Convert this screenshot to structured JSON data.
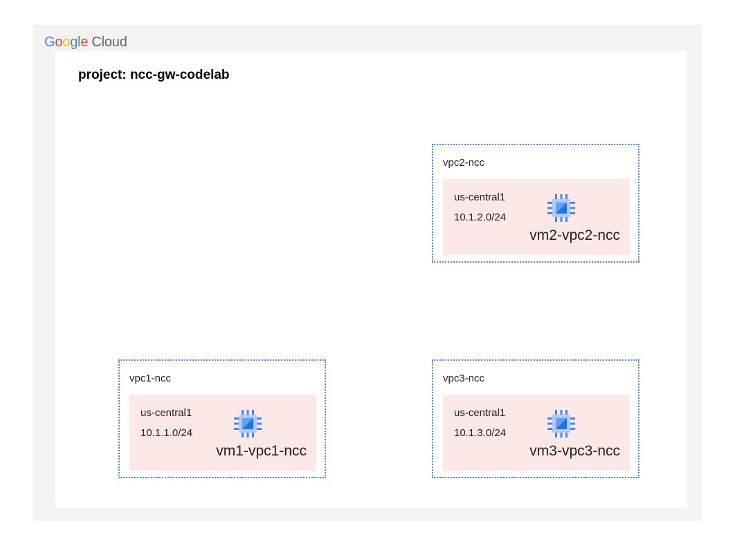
{
  "brand": {
    "google_letters": [
      {
        "ch": "G",
        "color": "#4285F4"
      },
      {
        "ch": "o",
        "color": "#EA4335"
      },
      {
        "ch": "o",
        "color": "#FBBC05"
      },
      {
        "ch": "g",
        "color": "#4285F4"
      },
      {
        "ch": "l",
        "color": "#34A853"
      },
      {
        "ch": "e",
        "color": "#EA4335"
      }
    ],
    "product": "Cloud"
  },
  "project": {
    "label": "project: ncc-gw-codelab"
  },
  "vpcs": {
    "vpc2": {
      "name": "vpc2-ncc",
      "region": "us-central1",
      "cidr": "10.1.2.0/24",
      "vm": "vm2-vpc2-ncc",
      "icon": "compute-engine-icon"
    },
    "vpc1": {
      "name": "vpc1-ncc",
      "region": "us-central1",
      "cidr": "10.1.1.0/24",
      "vm": "vm1-vpc1-ncc",
      "icon": "compute-engine-icon"
    },
    "vpc3": {
      "name": "vpc3-ncc",
      "region": "us-central1",
      "cidr": "10.1.3.0/24",
      "vm": "vm3-vpc3-ncc",
      "icon": "compute-engine-icon"
    }
  },
  "colors": {
    "vpc_border": "#4285F4",
    "subnet_fill": "#FDE8E8",
    "chip_blue": "#4285F4",
    "chip_light": "#AECBFA"
  }
}
